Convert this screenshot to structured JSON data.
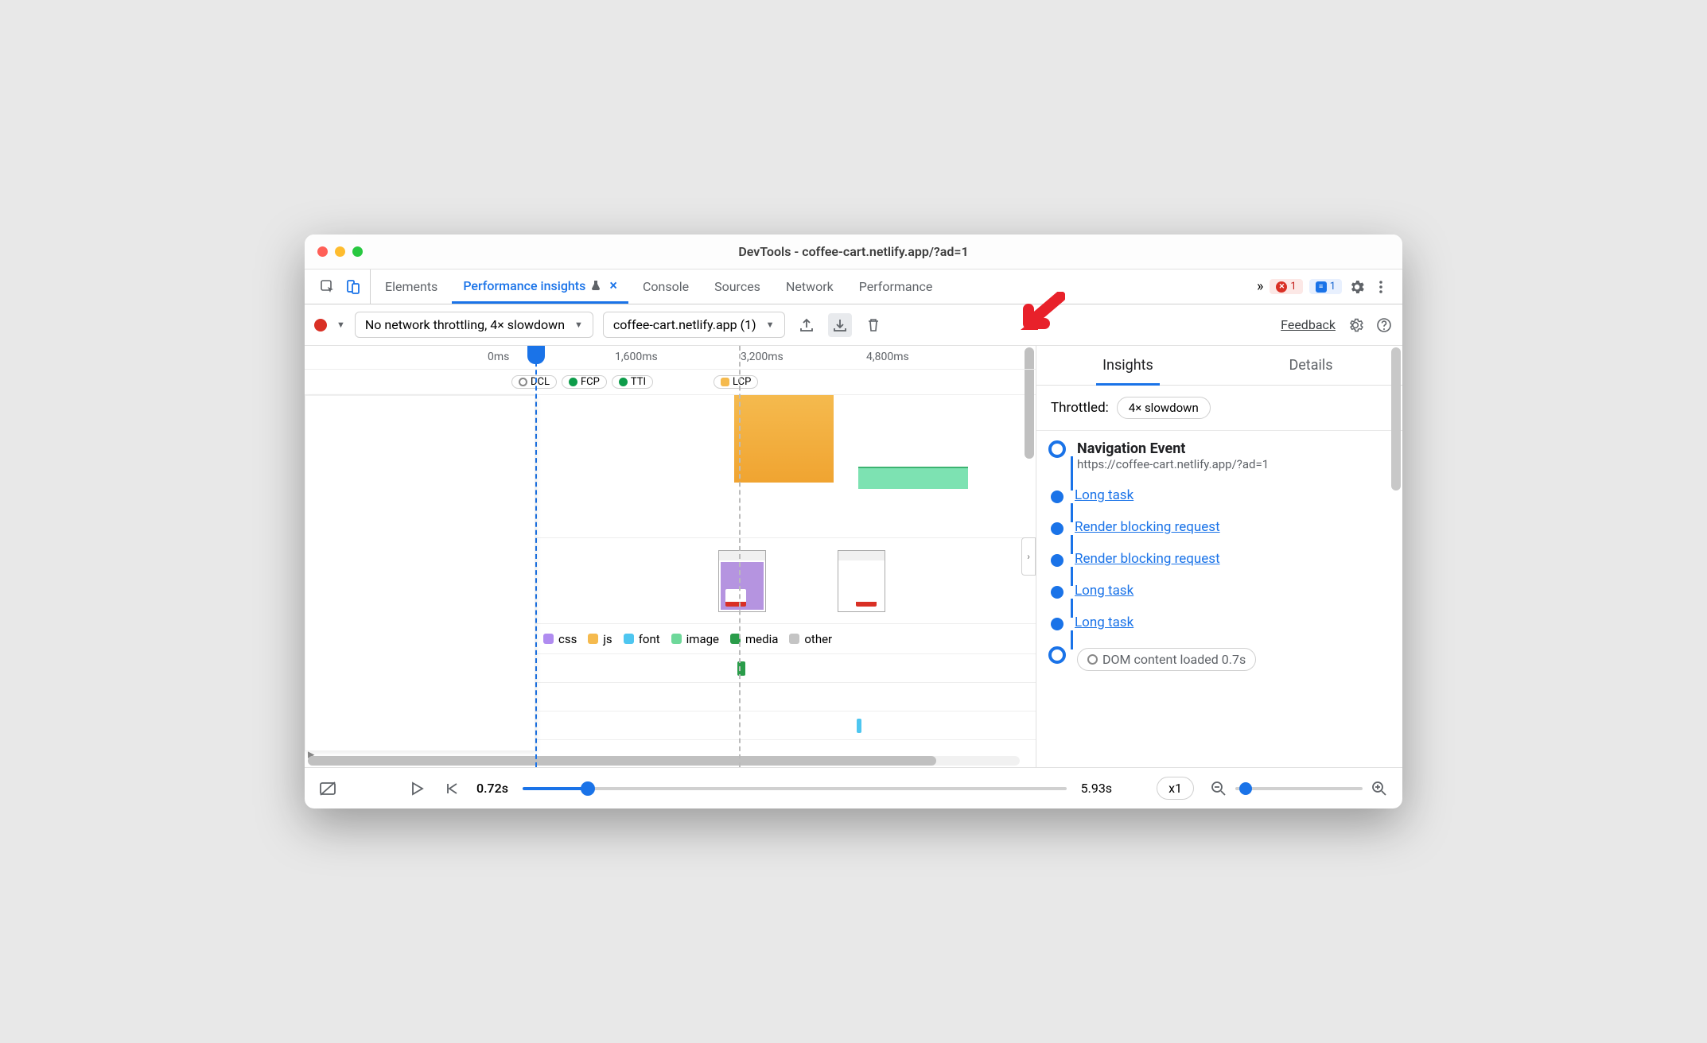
{
  "window": {
    "title": "DevTools - coffee-cart.netlify.app/?ad=1"
  },
  "tabs": {
    "elements": "Elements",
    "perfInsights": "Performance insights",
    "console": "Console",
    "sources": "Sources",
    "network": "Network",
    "performance": "Performance",
    "more": "»",
    "errorCount": "1",
    "msgCount": "1"
  },
  "toolbar": {
    "throttleSelect": "No network throttling, 4× slowdown",
    "recordingSelect": "coffee-cart.netlify.app (1)",
    "feedback": "Feedback"
  },
  "ruler": {
    "t0": "0ms",
    "t1": "1,600ms",
    "t2": "3,200ms",
    "t3": "4,800ms"
  },
  "markers": {
    "dcl": "DCL",
    "fcp": "FCP",
    "tti": "TTI",
    "lcp": "LCP"
  },
  "legend": {
    "css": "css",
    "js": "js",
    "font": "font",
    "image": "image",
    "media": "media",
    "other": "other"
  },
  "insights": {
    "tabInsights": "Insights",
    "tabDetails": "Details",
    "throttledLabel": "Throttled:",
    "throttledValue": "4× slowdown",
    "navTitle": "Navigation Event",
    "navUrl": "https://coffee-cart.netlify.app/?ad=1",
    "events": [
      "Long task",
      "Render blocking request",
      "Render blocking request",
      "Long task",
      "Long task"
    ],
    "domChip": "DOM content loaded 0.7s"
  },
  "footer": {
    "startTime": "0.72s",
    "endTime": "5.93s",
    "zoomLabel": "x1"
  },
  "colors": {
    "blue": "#1a73e8",
    "purple": "#b08cf0",
    "orange": "#f5ba4e",
    "cyan": "#4ec6f0",
    "green": "#4eca72",
    "darkgreen": "#2a9c4a",
    "grey": "#b8b8b8"
  }
}
